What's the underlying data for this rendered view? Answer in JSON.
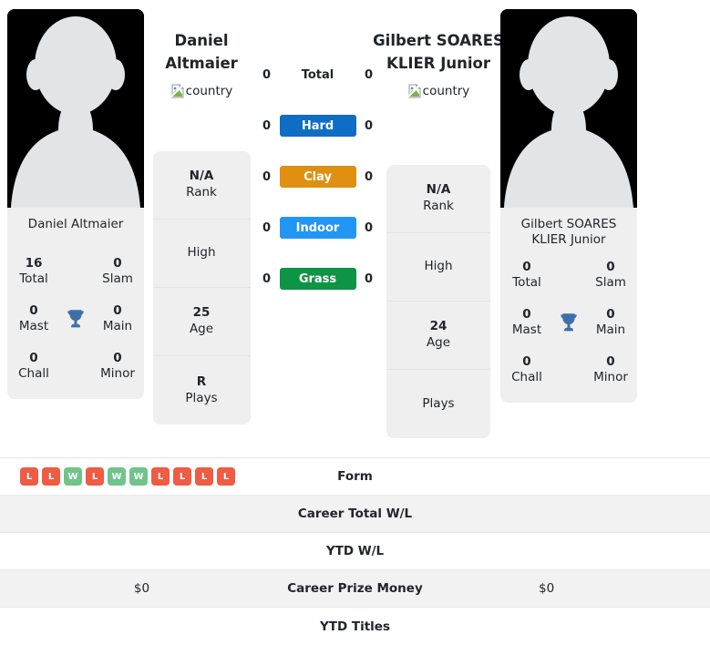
{
  "players": {
    "left": {
      "display_name": "Daniel Altmaier",
      "title_line1": "Daniel",
      "title_line2": "Altmaier",
      "country_alt": "country",
      "avatar_icon": "player-silhouette-icon",
      "titles": {
        "total_value": "16",
        "total_label": "Total",
        "slam_value": "0",
        "slam_label": "Slam",
        "mast_value": "0",
        "mast_label": "Mast",
        "main_value": "0",
        "main_label": "Main",
        "chall_value": "0",
        "chall_label": "Chall",
        "minor_value": "0",
        "minor_label": "Minor",
        "trophy_icon": "trophy-icon"
      },
      "info": [
        {
          "value": "N/A",
          "label": "Rank"
        },
        {
          "value": "",
          "label": "High"
        },
        {
          "value": "25",
          "label": "Age"
        },
        {
          "value": "R",
          "label": "Plays"
        }
      ],
      "form": [
        "L",
        "L",
        "W",
        "L",
        "W",
        "W",
        "L",
        "L",
        "L",
        "L"
      ],
      "career_total_wl": "",
      "ytd_wl": "",
      "career_prize_money": "$0",
      "ytd_titles": ""
    },
    "right": {
      "display_name": "Gilbert SOARES KLIER Junior",
      "title_line1": "Gilbert SOARES",
      "title_line2": "KLIER Junior",
      "country_alt": "country",
      "avatar_icon": "player-silhouette-icon",
      "titles": {
        "total_value": "0",
        "total_label": "Total",
        "slam_value": "0",
        "slam_label": "Slam",
        "mast_value": "0",
        "mast_label": "Mast",
        "main_value": "0",
        "main_label": "Main",
        "chall_value": "0",
        "chall_label": "Chall",
        "minor_value": "0",
        "minor_label": "Minor",
        "trophy_icon": "trophy-icon"
      },
      "info": [
        {
          "value": "N/A",
          "label": "Rank"
        },
        {
          "value": "",
          "label": "High"
        },
        {
          "value": "24",
          "label": "Age"
        },
        {
          "value": "",
          "label": "Plays"
        }
      ],
      "form": [],
      "career_total_wl": "",
      "ytd_wl": "",
      "career_prize_money": "$0",
      "ytd_titles": ""
    }
  },
  "surfaces": [
    {
      "key": "total",
      "label": "Total",
      "left": "0",
      "right": "0",
      "color": "transparent",
      "text_color": "#212529"
    },
    {
      "key": "hard",
      "label": "Hard",
      "left": "0",
      "right": "0",
      "color": "#0d6ec4",
      "text_color": "#ffffff"
    },
    {
      "key": "clay",
      "label": "Clay",
      "left": "0",
      "right": "0",
      "color": "#e09010",
      "text_color": "#ffffff"
    },
    {
      "key": "indoor",
      "label": "Indoor",
      "left": "0",
      "right": "0",
      "color": "#2196f3",
      "text_color": "#ffffff"
    },
    {
      "key": "grass",
      "label": "Grass",
      "left": "0",
      "right": "0",
      "color": "#0d9444",
      "text_color": "#ffffff"
    }
  ],
  "stat_rows": [
    {
      "key": "form",
      "label": "Form",
      "left": "",
      "right": ""
    },
    {
      "key": "career_total_wl",
      "label": "Career Total W/L",
      "left": "",
      "right": ""
    },
    {
      "key": "ytd_wl",
      "label": "YTD W/L",
      "left": "",
      "right": ""
    },
    {
      "key": "career_prize_money",
      "label": "Career Prize Money",
      "left": "$0",
      "right": "$0"
    },
    {
      "key": "ytd_titles",
      "label": "YTD Titles",
      "left": "",
      "right": ""
    }
  ],
  "colors": {
    "win_badge": "#70c48a",
    "loss_badge": "#ee5c43",
    "card_bg": "#efefef",
    "row_alt_bg": "#f2f2f2"
  }
}
